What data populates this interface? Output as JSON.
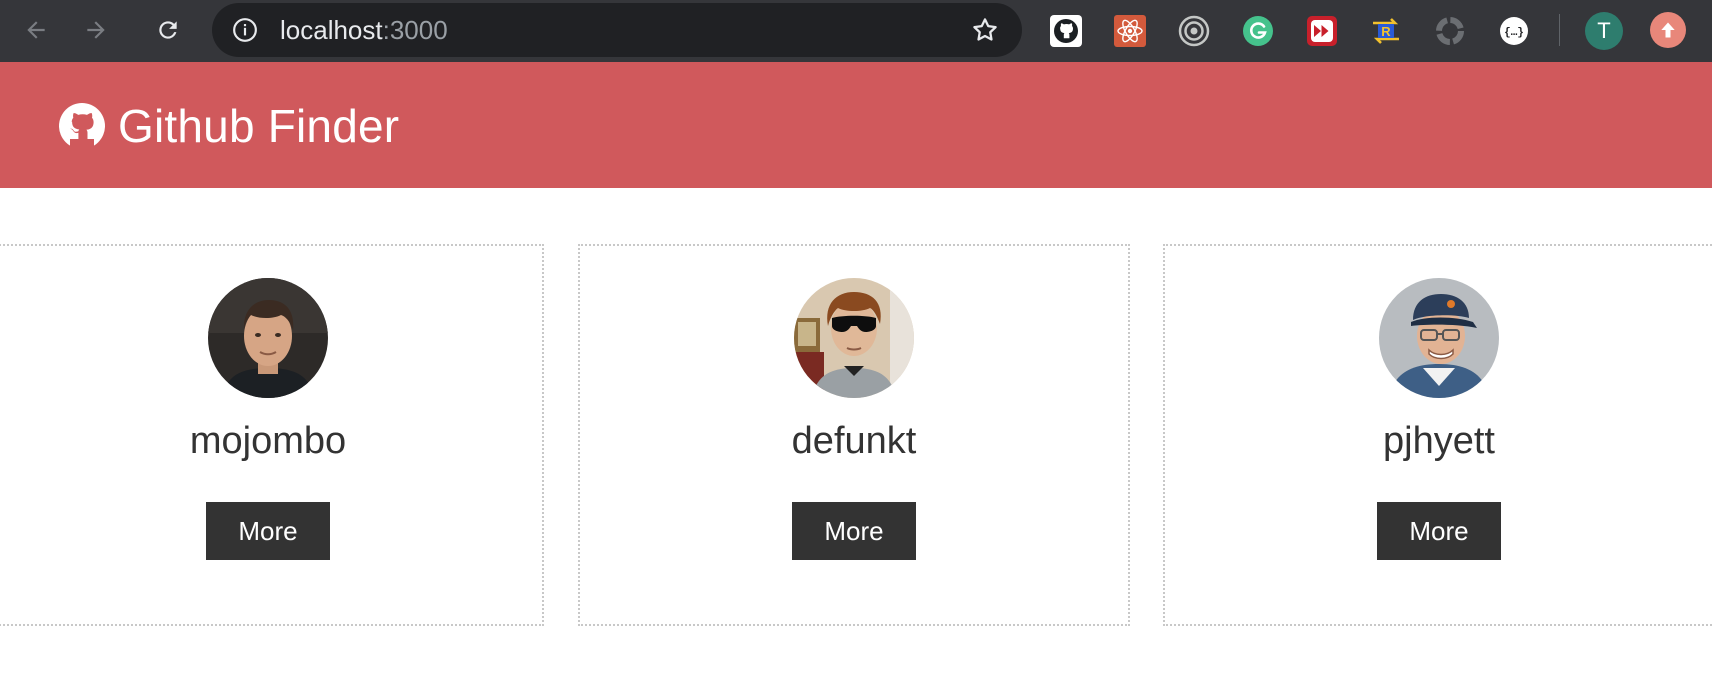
{
  "browser": {
    "url_host": "localhost",
    "url_port": ":3000",
    "profile_initial": "T",
    "icons": {
      "back": "arrow-left-icon",
      "forward": "arrow-right-icon",
      "reload": "reload-icon",
      "info": "info-icon",
      "bookmark": "star-icon",
      "update": "arrow-up-icon"
    },
    "extensions": [
      {
        "name": "github-extension-icon"
      },
      {
        "name": "react-devtools-icon"
      },
      {
        "name": "target-extension-icon"
      },
      {
        "name": "grammarly-icon"
      },
      {
        "name": "fast-forward-extension-icon"
      },
      {
        "name": "redux-devtools-icon"
      },
      {
        "name": "loading-extension-icon"
      },
      {
        "name": "json-viewer-icon"
      }
    ]
  },
  "app": {
    "title": "Github Finder",
    "brand_icon": "github-icon",
    "accent_color": "#d0595c"
  },
  "users": [
    {
      "login": "mojombo",
      "more_label": "More",
      "avatar": "avatar-mojombo"
    },
    {
      "login": "defunkt",
      "more_label": "More",
      "avatar": "avatar-defunkt"
    },
    {
      "login": "pjhyett",
      "more_label": "More",
      "avatar": "avatar-pjhyett"
    }
  ]
}
